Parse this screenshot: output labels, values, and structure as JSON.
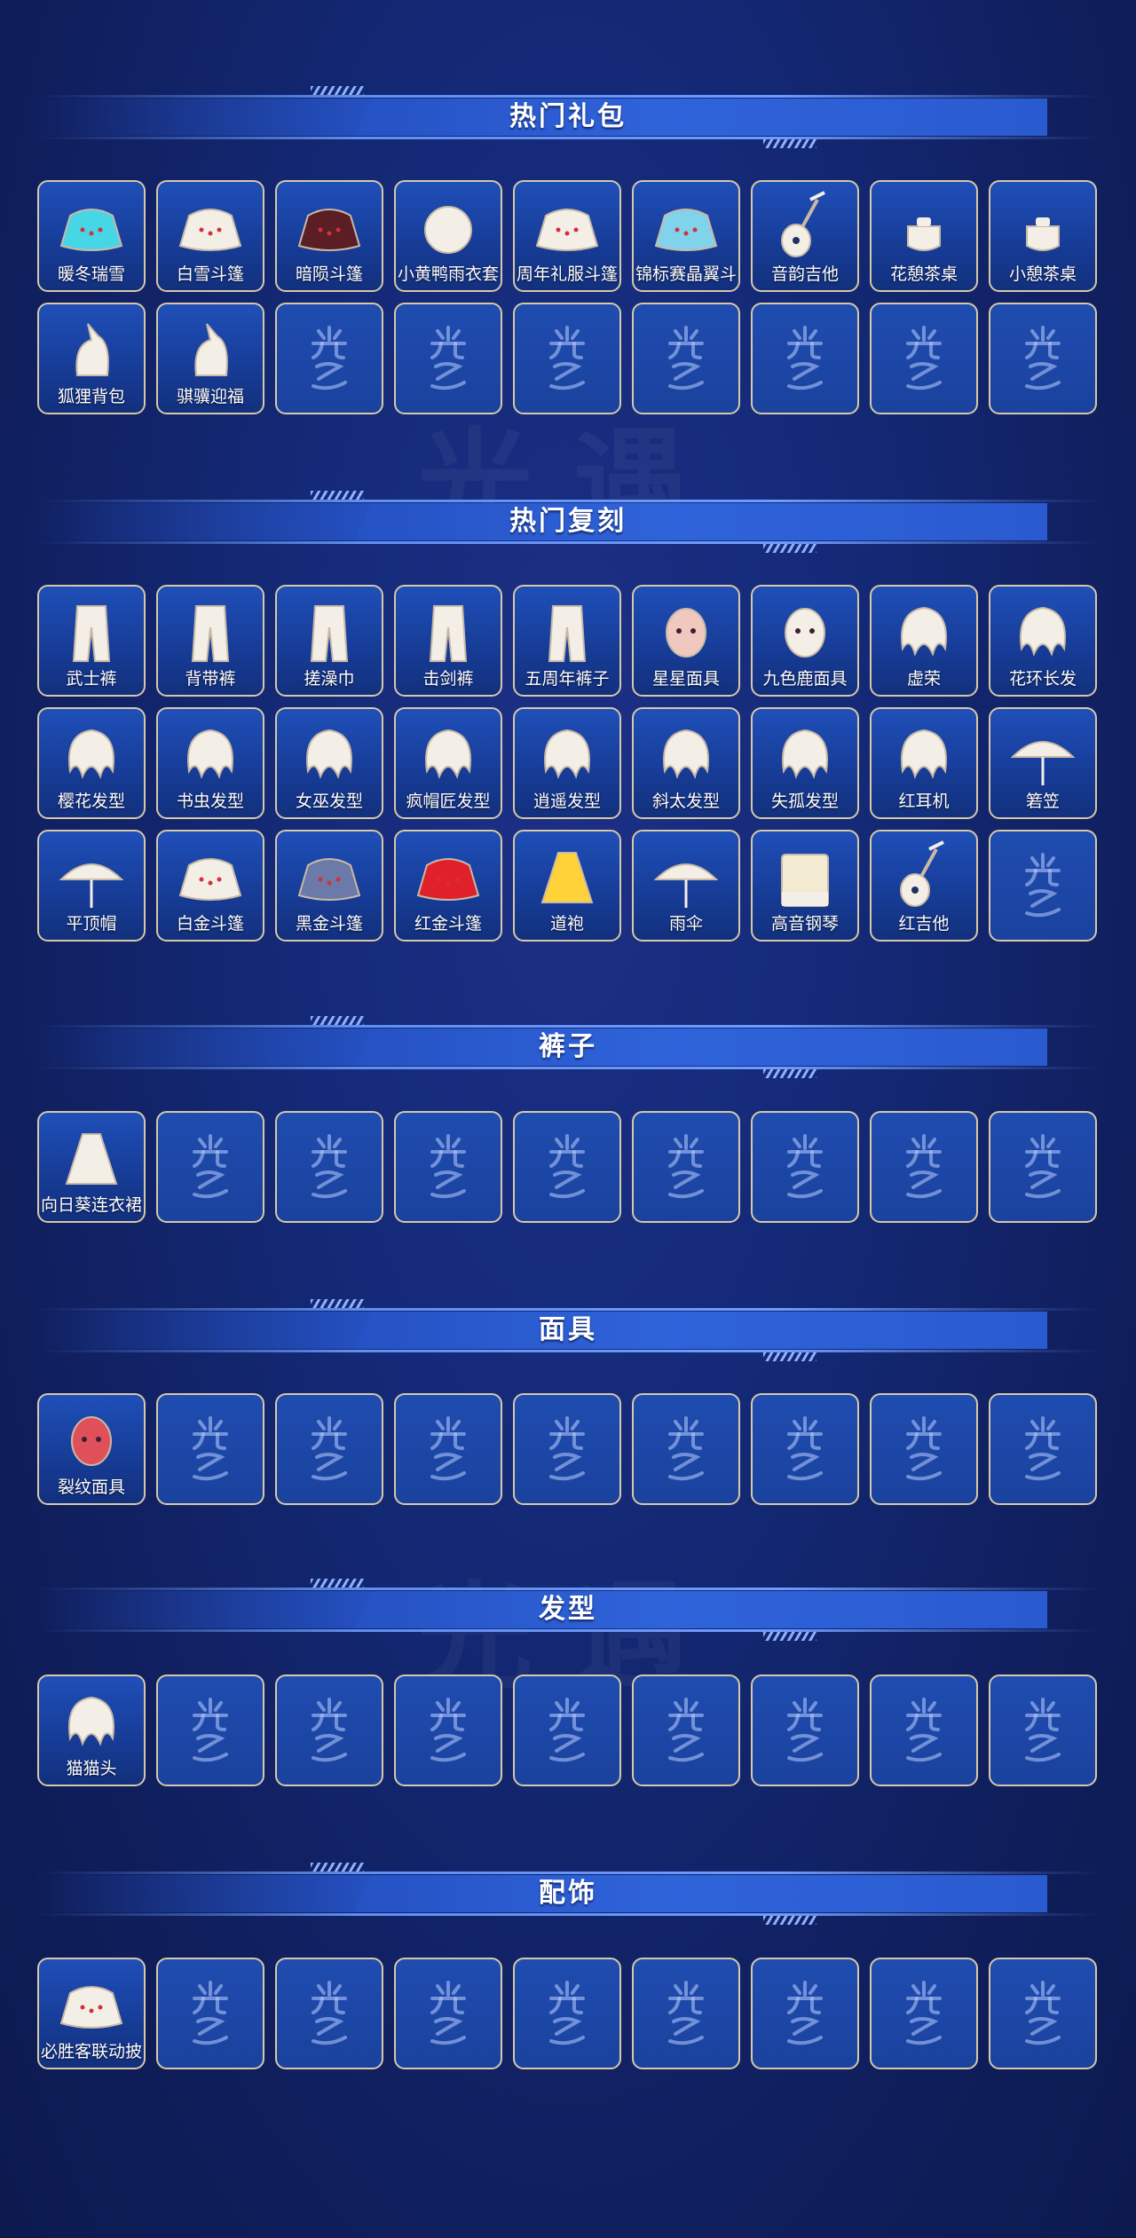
{
  "sections": [
    {
      "title": "热门礼包",
      "items": [
        {
          "label": "暖冬瑞雪",
          "icon": "cyan-cape-icon"
        },
        {
          "label": "白雪斗篷",
          "icon": "white-cape-icon"
        },
        {
          "label": "暗陨斗篷",
          "icon": "dark-red-cape-icon"
        },
        {
          "label": "小黄鸭雨衣套",
          "icon": "duck-raincoat-icon"
        },
        {
          "label": "周年礼服斗篷",
          "icon": "anniversary-cloak-icon"
        },
        {
          "label": "锦标赛晶翼斗",
          "icon": "crystal-wing-cape-icon"
        },
        {
          "label": "音韵吉他",
          "icon": "guitar-icon"
        },
        {
          "label": "花憩茶桌",
          "icon": "tea-table-icon"
        },
        {
          "label": "小憩茶桌",
          "icon": "teapot-icon"
        },
        {
          "label": "狐狸背包",
          "icon": "fox-backpack-icon"
        },
        {
          "label": "骐骥迎福",
          "icon": "horse-icon"
        }
      ],
      "empty_count": 7
    },
    {
      "title": "热门复刻",
      "items": [
        {
          "label": "武士裤",
          "icon": "samurai-pants-icon"
        },
        {
          "label": "背带裤",
          "icon": "overalls-icon"
        },
        {
          "label": "搓澡巾",
          "icon": "bath-towel-pants-icon"
        },
        {
          "label": "击剑裤",
          "icon": "fencing-outfit-icon"
        },
        {
          "label": "五周年裤子",
          "icon": "anniversary-pants-icon"
        },
        {
          "label": "星星面具",
          "icon": "star-mask-icon"
        },
        {
          "label": "九色鹿面具",
          "icon": "deer-mask-icon"
        },
        {
          "label": "虚荣",
          "icon": "long-hair-icon"
        },
        {
          "label": "花环长发",
          "icon": "flower-crown-hair-icon"
        },
        {
          "label": "樱花发型",
          "icon": "sakura-hair-icon"
        },
        {
          "label": "书虫发型",
          "icon": "bookworm-hair-icon"
        },
        {
          "label": "女巫发型",
          "icon": "witch-hair-icon"
        },
        {
          "label": "疯帽匠发型",
          "icon": "hatter-hair-icon"
        },
        {
          "label": "逍遥发型",
          "icon": "ponytail-hair-icon"
        },
        {
          "label": "斜太发型",
          "icon": "bob-hair-icon"
        },
        {
          "label": "失孤发型",
          "icon": "wild-hair-icon"
        },
        {
          "label": "红耳机",
          "icon": "headphones-icon"
        },
        {
          "label": "箬笠",
          "icon": "bamboo-hat-icon"
        },
        {
          "label": "平顶帽",
          "icon": "flat-cap-icon"
        },
        {
          "label": "白金斗篷",
          "icon": "white-gold-cape-icon"
        },
        {
          "label": "黑金斗篷",
          "icon": "black-gold-cape-icon"
        },
        {
          "label": "红金斗篷",
          "icon": "red-gold-cape-icon"
        },
        {
          "label": "道袍",
          "icon": "robe-icon"
        },
        {
          "label": "雨伞",
          "icon": "umbrella-icon"
        },
        {
          "label": "高音钢琴",
          "icon": "piano-icon"
        },
        {
          "label": "红吉他",
          "icon": "red-guitar-icon"
        }
      ],
      "empty_count": 1
    },
    {
      "title": "裤子",
      "items": [
        {
          "label": "向日葵连衣裙",
          "icon": "sunflower-dress-icon"
        }
      ],
      "empty_count": 8
    },
    {
      "title": "面具",
      "items": [
        {
          "label": "裂纹面具",
          "icon": "cracked-mask-icon"
        }
      ],
      "empty_count": 8
    },
    {
      "title": "发型",
      "items": [
        {
          "label": "猫猫头",
          "icon": "cat-head-hair-icon"
        }
      ],
      "empty_count": 8
    },
    {
      "title": "配饰",
      "items": [
        {
          "label": "必胜客联动披",
          "icon": "pizza-box-cape-icon"
        }
      ],
      "empty_count": 8
    }
  ],
  "colors": {
    "background": "#142a78",
    "banner": "#2a5ad0",
    "tile": "#1a429e",
    "tile_border": "#d7c8a8",
    "text": "#ffffff"
  }
}
